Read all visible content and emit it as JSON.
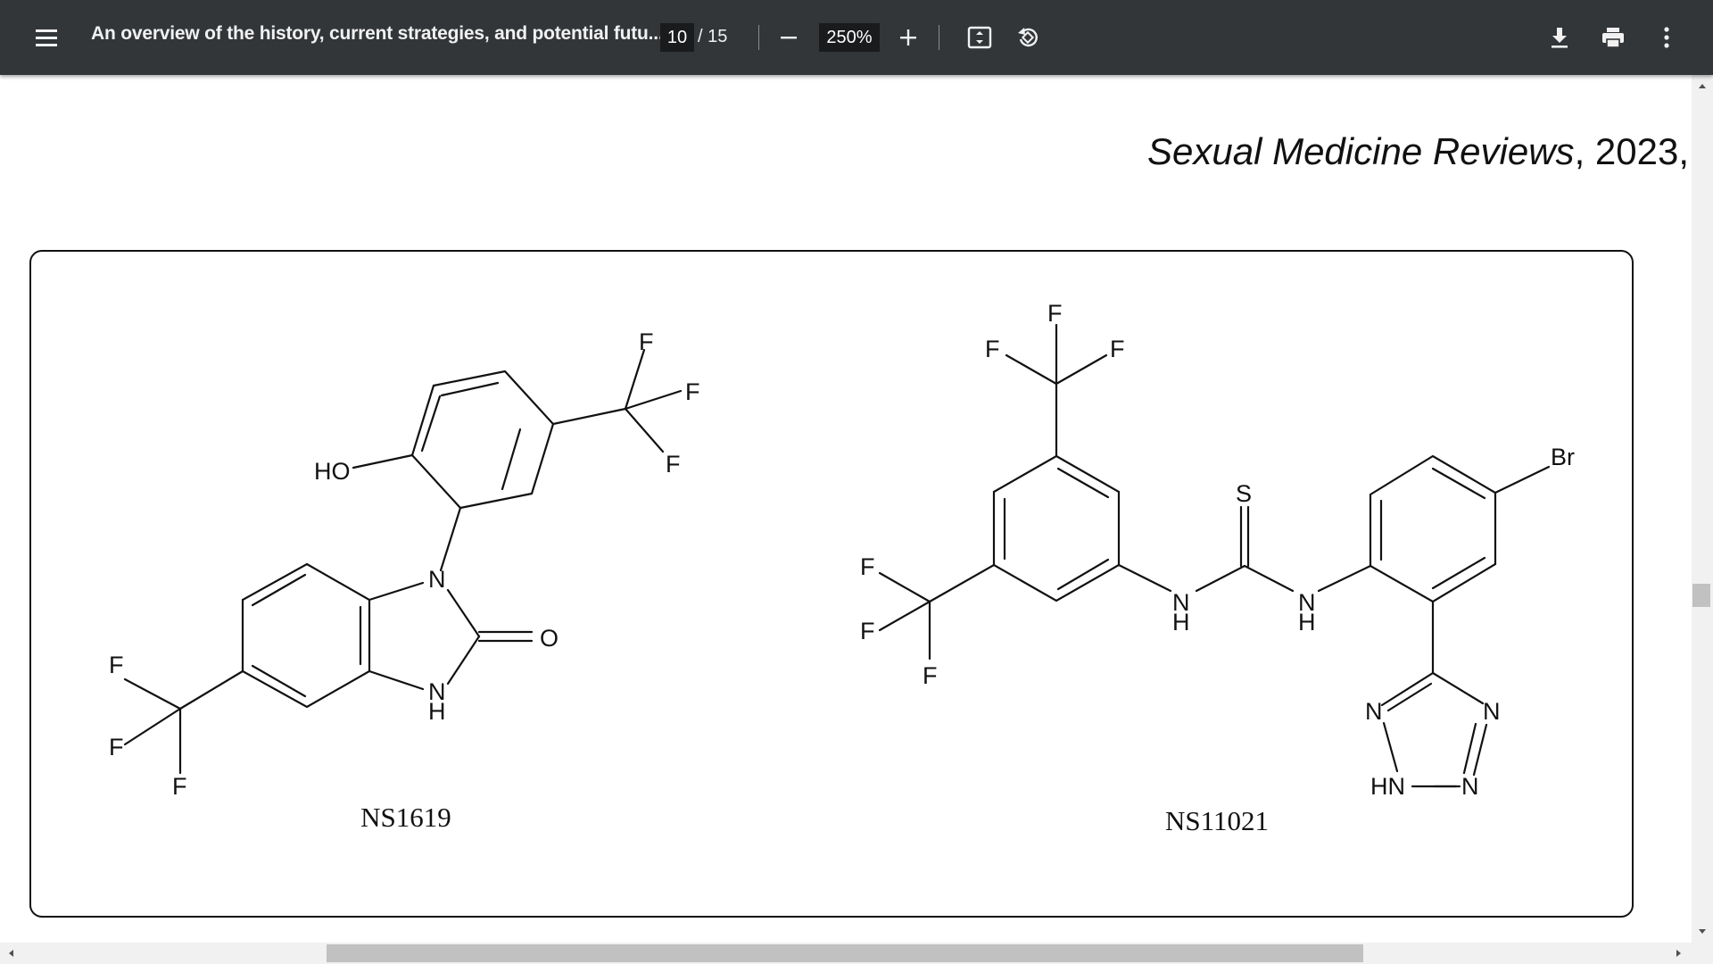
{
  "toolbar": {
    "menu_icon": "hamburger-menu-icon",
    "title": "An overview of the history, current strategies, and potential futu...",
    "page_current": "10",
    "page_total": "/ 15",
    "zoom_out_icon": "minus-icon",
    "zoom_value": "250%",
    "zoom_in_icon": "plus-icon",
    "fit_icon": "fit-page-icon",
    "rotate_icon": "rotate-icon",
    "download_icon": "download-icon",
    "print_icon": "print-icon",
    "more_icon": "more-vertical-icon"
  },
  "document": {
    "journal_name": "Sexual Medicine Reviews",
    "journal_year": ", 2023,",
    "figure": {
      "left_compound": {
        "name": "NS1619",
        "atoms": {
          "hydroxyl": "HO",
          "f1": "F",
          "f2": "F",
          "f3": "F",
          "f4": "F",
          "f5": "F",
          "f6": "F",
          "n_top": "N",
          "n_bottom": "N",
          "h_bottom": "H",
          "oxygen": "O"
        }
      },
      "right_compound": {
        "name": "NS11021",
        "atoms": {
          "f1": "F",
          "f2": "F",
          "f3": "F",
          "f4": "F",
          "f5": "F",
          "f6": "F",
          "sulfur": "S",
          "n1": "N",
          "h1": "H",
          "n2": "N",
          "h2": "H",
          "bromine": "Br",
          "tz_n1": "N",
          "tz_n2": "N",
          "tz_hn": "HN",
          "tz_n3": "N"
        }
      }
    }
  },
  "colors": {
    "toolbar_bg": "#323639",
    "page_bg": "#ffffff",
    "ink": "#111111"
  }
}
